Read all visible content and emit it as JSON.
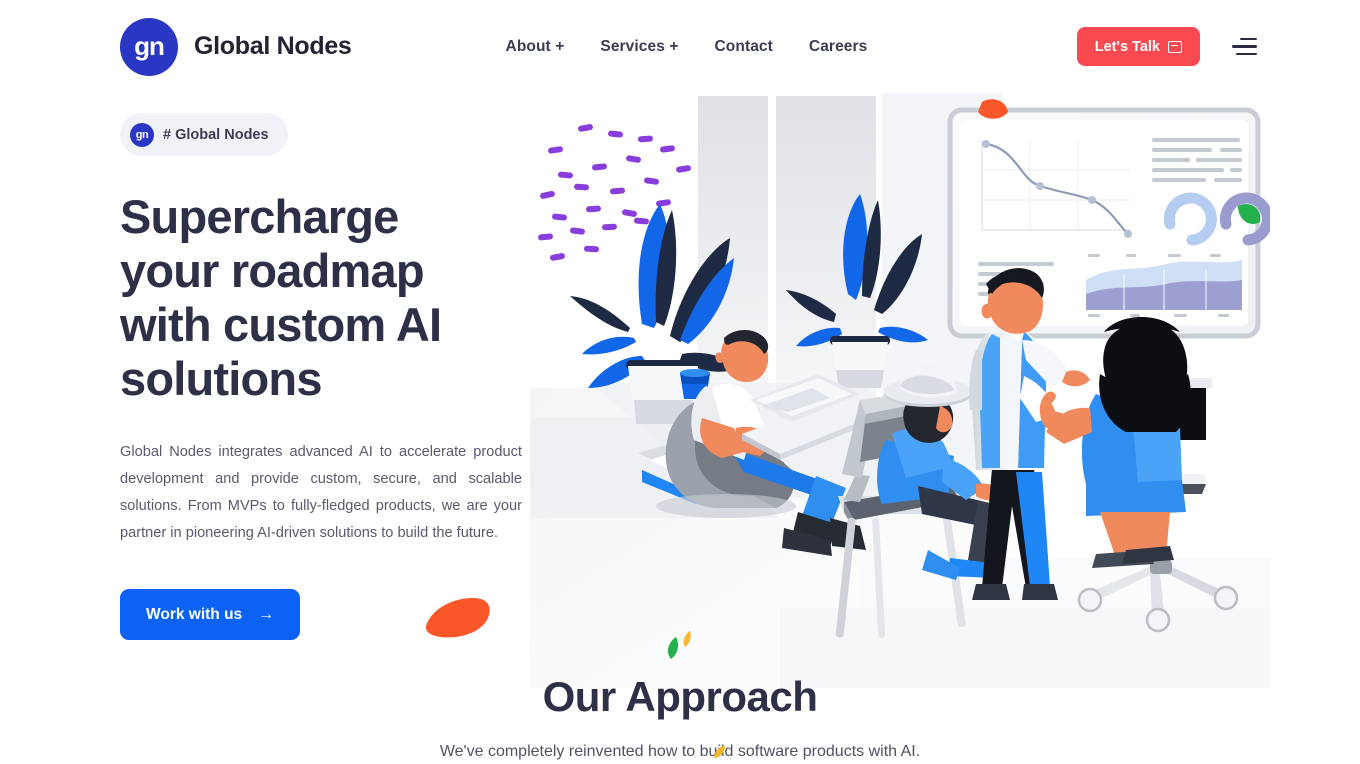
{
  "header": {
    "logo_text": "gn",
    "brand_name": "Global Nodes",
    "nav": [
      {
        "label": "About +",
        "name": "nav-item-about"
      },
      {
        "label": "Services +",
        "name": "nav-item-services"
      },
      {
        "label": "Contact",
        "name": "nav-item-contact"
      },
      {
        "label": "Careers",
        "name": "nav-item-careers"
      }
    ],
    "cta_label": "Let's Talk",
    "cta_icon": "chat-icon",
    "menu_icon": "hamburger-menu-icon"
  },
  "hero": {
    "badge_logo_text": "gn",
    "badge_label": "# Global Nodes",
    "headline_line1": "Supercharge",
    "headline_line2": "your roadmap",
    "headline_line3": "with custom AI",
    "headline_line4": "solutions",
    "paragraph": "Global Nodes integrates advanced AI to accelerate product development and provide custom, secure, and scalable solutions. From MVPs to fully-fledged products, we are your partner in pioneering AI-driven solutions to build the future.",
    "button_label": "Work with us",
    "button_icon": "arrow-right-icon"
  },
  "approach": {
    "title": "Our Approach",
    "subtitle": "We've completely reinvented how to build software products with AI."
  },
  "colors": {
    "brand_blue": "#2a36c4",
    "accent_blue": "#0b62f4",
    "cta_red": "#f94a52",
    "text_dark": "#2e3047",
    "text_gray": "#585a6e",
    "badge_bg": "#f1f2f7",
    "decor_purple": "#8a3ddd",
    "decor_orange": "#f9572a",
    "decor_green": "#22b14c",
    "decor_yellow": "#f5b731"
  }
}
